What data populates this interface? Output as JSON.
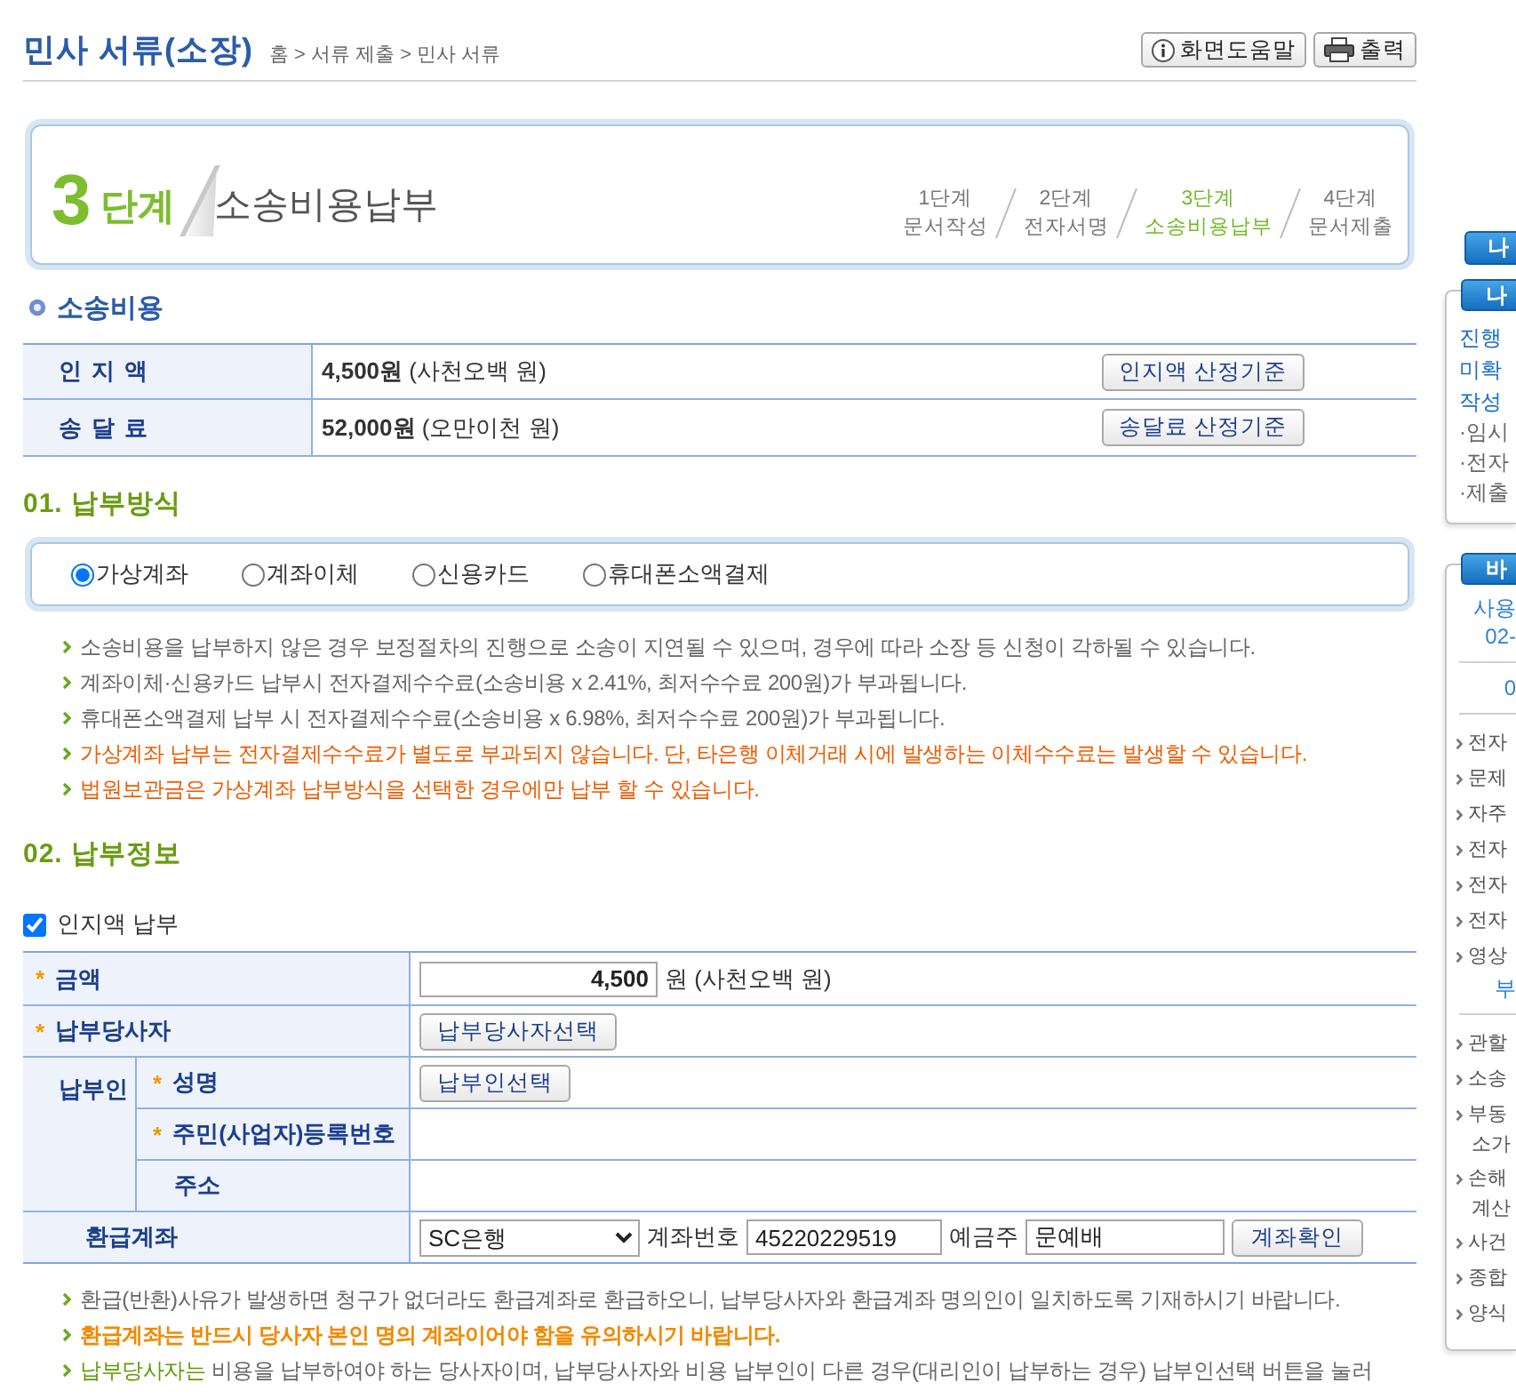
{
  "header": {
    "title": "민사 서류(소장)",
    "breadcrumb": "홈 > 서류 제출 > 민사 서류",
    "buttons": [
      {
        "kind": "help",
        "label": "화면도움말"
      },
      {
        "kind": "print",
        "label": "출력"
      }
    ]
  },
  "step_banner": {
    "number": "3",
    "unit": "단계",
    "title": "소송비용납부",
    "steps": [
      {
        "step": "1단계",
        "name": "문서작성",
        "selected": false
      },
      {
        "step": "2단계",
        "name": "전자서명",
        "selected": false
      },
      {
        "step": "3단계",
        "name": "소송비용납부",
        "selected": true
      },
      {
        "step": "4단계",
        "name": "문서제출",
        "selected": false
      }
    ]
  },
  "costs": {
    "title": "소송비용",
    "rows": [
      {
        "label": "인 지 액",
        "amount": "**4,500원** (사천오백 원)",
        "button": "인지액 산정기준"
      },
      {
        "label": "송 달 료",
        "amount": "**52,000원** (오만이천 원)",
        "button": "송달료 산정기준"
      }
    ]
  },
  "payment_method": {
    "title": "01. 납부방식",
    "options": [
      {
        "label": "가상계좌",
        "selected": true
      },
      {
        "label": "계좌이체",
        "selected": false
      },
      {
        "label": "신용카드",
        "selected": false
      },
      {
        "label": "휴대폰소액결제",
        "selected": false
      }
    ],
    "notes": [
      {
        "kind": "info",
        "text": "소송비용을 납부하지 않은 경우 보정절차의 진행으로 소송이 지연될 수 있으며, 경우에 따라 소장 등 신청이 각하될 수 있습니다."
      },
      {
        "kind": "info",
        "text": "계좌이체·신용카드 납부시 전자결제수수료(소송비용 x 2.41%, 최저수수료 200원)가 부과됩니다."
      },
      {
        "kind": "info",
        "text": "휴대폰소액결제 납부 시 전자결제수수료(소송비용 x 6.98%, 최저수수료 200원)가 부과됩니다."
      },
      {
        "kind": "warning",
        "text": "가상계좌 납부는 전자결제수수료가 별도로 부과되지 않습니다. 단, 타은행 이체거래 시에 발생하는 이체수수료는 발생할 수 있습니다."
      },
      {
        "kind": "warning",
        "text": "법원보관금은 가상계좌 납부방식을 선택한 경우에만 납부 할 수 있습니다."
      }
    ]
  },
  "payment_info": {
    "title": "02. 납부정보",
    "stamp_payment": {
      "label": "인지액 납부",
      "checked": true
    },
    "rows": [
      {
        "kind": "amount",
        "required_mark": "*",
        "label": "금액",
        "value": "4,500",
        "suffix": "원 (사천오백 원)"
      },
      {
        "kind": "party",
        "required_mark": "*",
        "label": "납부당사자",
        "button": "납부당사자선택"
      },
      {
        "kind": "payer",
        "label": "납부인",
        "fields": [
          {
            "required_mark": "*",
            "label": "성명",
            "button": "납부인선택"
          },
          {
            "required_mark": "*",
            "label": "주민(사업자)등록번호"
          },
          {
            "label": "주소"
          }
        ]
      },
      {
        "kind": "refund",
        "label": "환급계좌",
        "bank": "SC은행",
        "account_label": "계좌번호",
        "account": "45220229519",
        "holder_label": "예금주",
        "holder": "문예배",
        "button": "계좌확인"
      }
    ],
    "notes": [
      {
        "kind": "info",
        "text": "환급(반환)사유가 발생하면 청구가 없더라도 환급계좌로 환급하오니, 납부당사자와 환급계좌 명의인이 일치하도록 기재하시기 바랍니다."
      },
      {
        "kind": "alert",
        "text": "환급계좌는 반드시 당사자 본인 명의 계좌이어야 함을 유의하시기 바랍니다."
      },
      {
        "kind": "info",
        "text": "**납부당사자는** 비용을 납부하여야 하는 당사자이며, 납부당사자와 비용 납부인이 다른 경우(대리인이 납부하는 경우) 납부인선택 버튼을 눌러"
      }
    ]
  },
  "sidebar": {
    "top_button": "나",
    "panels": [
      {
        "tab": "나",
        "groups": [
          [
            {
              "kind": "link",
              "text": "진행"
            },
            {
              "kind": "link",
              "text": "미확"
            },
            {
              "kind": "link",
              "text": "작성"
            },
            {
              "kind": "plain",
              "text": "·임시"
            },
            {
              "kind": "plain",
              "text": "·전자"
            },
            {
              "kind": "plain",
              "text": "·제출"
            }
          ]
        ]
      },
      {
        "tab": "바",
        "groups": [
          [
            {
              "kind": "center",
              "text": "사용"
            },
            {
              "kind": "center",
              "text": "02-"
            }
          ],
          [
            {
              "kind": "center",
              "text": "0"
            }
          ],
          [
            {
              "kind": "menu",
              "text": "전자"
            },
            {
              "kind": "menu",
              "text": "문제"
            },
            {
              "kind": "menu",
              "text": "자주"
            },
            {
              "kind": "menu",
              "text": "전자"
            },
            {
              "kind": "menu",
              "text": "전자"
            },
            {
              "kind": "menu",
              "text": "전자"
            },
            {
              "kind": "menu",
              "text": "영상"
            },
            {
              "kind": "center",
              "text": "부"
            }
          ],
          [
            {
              "kind": "menu",
              "text": "관할"
            },
            {
              "kind": "menu",
              "text": "소송"
            },
            {
              "kind": "menu",
              "text": "부동",
              "continuation": "소가"
            },
            {
              "kind": "menu",
              "text": "손해",
              "continuation": "계산"
            },
            {
              "kind": "menu",
              "text": "사건"
            },
            {
              "kind": "menu",
              "text": "종합"
            },
            {
              "kind": "menu",
              "text": "양식"
            }
          ]
        ]
      }
    ]
  }
}
